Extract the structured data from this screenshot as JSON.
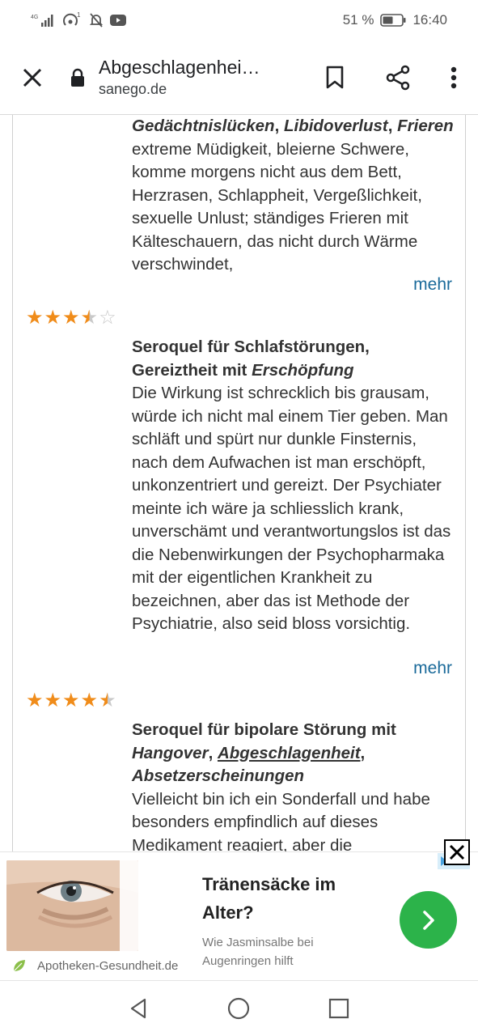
{
  "status_bar": {
    "network": "4G",
    "signal_label": "1",
    "battery": "51 %",
    "time": "16:40"
  },
  "header": {
    "title": "Abgeschlagenhei…",
    "url": "sanego.de"
  },
  "reviews": [
    {
      "lead_parts": [
        "Gedächtnislücken",
        ", ",
        "Libidoverlust",
        ", ",
        "Frieren"
      ],
      "body": "extreme Müdigkeit, bleierne Schwere, komme morgens nicht aus dem Bett, Herzrasen, Schlappheit, Vergeßlichkeit, sexuelle Unlust; ständiges Frieren mit Kälteschauern, das nicht durch Wärme verschwindet,",
      "more": "mehr"
    },
    {
      "rating": 3.5,
      "lead_plain": "Seroquel für Schlafstörungen, Gereiztheit mit ",
      "lead_italic": "Erschöpfung",
      "body": "Die Wirkung ist schrecklich bis grausam, würde ich nicht mal einem Tier geben. Man schläft und spürt nur dunkle Finsternis, nach dem Aufwachen ist man erschöpft, unkonzentriert und gereizt. Der Psychiater meinte ich wäre ja schliesslich krank, unverschämt und verantwortungslos ist das die Nebenwirkungen der Psychopharmaka mit der eigentlichen Krankheit zu bezeichnen, aber das ist Methode der Psychiatrie, also seid bloss vorsichtig.",
      "more": "mehr"
    },
    {
      "rating": 4.5,
      "lead_plain": "Seroquel für bipolare Störung mit ",
      "lead_italic_1": "Hangover",
      "lead_sep_1": ", ",
      "lead_underlined": "Abgeschlagenheit",
      "lead_sep_2": ",",
      "lead_italic_2": "Absetzerscheinungen",
      "body": "Vielleicht bin ich ein Sonderfall und habe besonders empfindlich auf dieses Medikament reagiert, aber die"
    }
  ],
  "ad": {
    "headline": "Tränensäcke im Alter?",
    "description": "Wie Jasminsalbe bei Augenringen hilft",
    "brand": "Apotheken-Gesundheit.de",
    "cta_color": "#2cb34a"
  },
  "colors": {
    "star": "#f08c1a",
    "link": "#1a6a9a"
  }
}
